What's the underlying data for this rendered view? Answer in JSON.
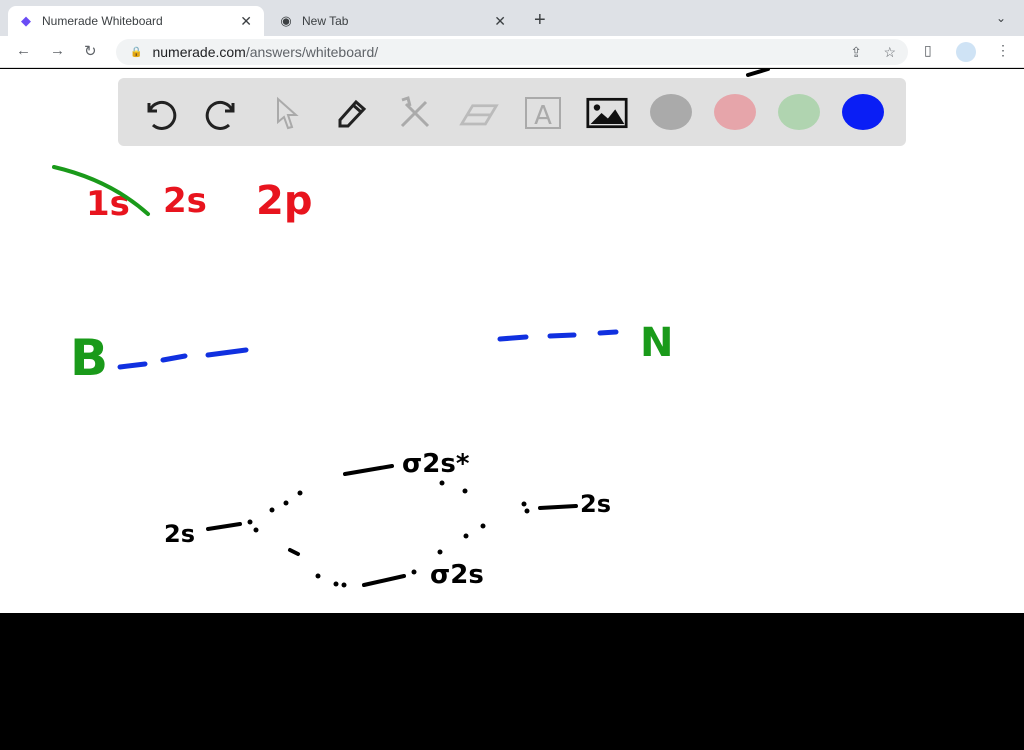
{
  "browser": {
    "tabs": [
      {
        "title": "Numerade Whiteboard",
        "icon": "numerade-logo-icon",
        "active": true
      },
      {
        "title": "New Tab",
        "icon": "chrome-icon",
        "active": false
      }
    ],
    "url_host": "numerade.com",
    "url_path": "/answers/whiteboard/"
  },
  "toolbar": {
    "tools": [
      "undo-icon",
      "redo-icon",
      "pointer-icon",
      "pen-icon",
      "tools-icon",
      "eraser-icon",
      "text-icon",
      "image-icon"
    ],
    "colors": [
      "#aaaaaa",
      "#e6a5aa",
      "#b0d4b0",
      "#0a1ef5"
    ]
  },
  "whiteboard": {
    "orbitals": [
      "1s",
      "2s",
      "2p"
    ],
    "atom_left": "B",
    "atom_right": "N",
    "label_2s_left": "2s",
    "label_2s_right": "2s",
    "label_sigma_star": "σ2s*",
    "label_sigma": "σ2s"
  },
  "colors": {
    "red": "#e8141e",
    "green": "#1a9a1a",
    "blue": "#1030e0",
    "ink": "#000000"
  }
}
